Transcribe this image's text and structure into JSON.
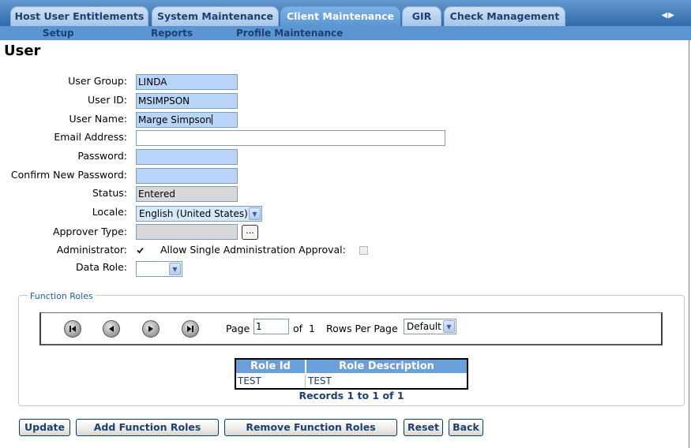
{
  "tabs": [
    {
      "label": "Host User Entitlements",
      "active": false
    },
    {
      "label": "System Maintenance",
      "active": false
    },
    {
      "label": "Client Maintenance",
      "active": true
    },
    {
      "label": "GIR",
      "active": false
    },
    {
      "label": "Check Management",
      "active": false
    }
  ],
  "tab_scroll_icon": "left-right-arrows",
  "subnav": [
    "Setup",
    "Reports",
    "Profile Maintenance"
  ],
  "page_title": "User",
  "form": {
    "user_group": {
      "label": "User Group:",
      "value": "LINDA"
    },
    "user_id": {
      "label": "User ID:",
      "value": "MSIMPSON"
    },
    "user_name": {
      "label": "User Name:",
      "value": "Marge Simpson"
    },
    "email": {
      "label": "Email Address:",
      "value": ""
    },
    "password": {
      "label": "Password:",
      "value": ""
    },
    "confirm_password": {
      "label": "Confirm New Password:",
      "value": ""
    },
    "status": {
      "label": "Status:",
      "value": "Entered"
    },
    "locale": {
      "label": "Locale:",
      "value": "English (United States)"
    },
    "approver_type": {
      "label": "Approver Type:",
      "value": "",
      "button": "..."
    },
    "administrator": {
      "label": "Administrator:",
      "checked": true
    },
    "allow_single_approval": {
      "label": "Allow Single Administration Approval:",
      "checked": false
    },
    "data_role": {
      "label": "Data Role:",
      "value": ""
    }
  },
  "function_roles": {
    "legend": "Function Roles",
    "pager": {
      "page_label": "Page",
      "page_value": "1",
      "of_label": "of",
      "total_pages": "1",
      "rows_per_page_label": "Rows Per Page",
      "rows_per_page_value": "Default"
    },
    "columns": [
      "Role Id",
      "Role Description"
    ],
    "rows": [
      [
        "TEST",
        "TEST"
      ]
    ],
    "records_text": "Records 1 to 1 of 1"
  },
  "buttons": {
    "update": "Update",
    "add_roles": "Add Function Roles",
    "remove_roles": "Remove Function Roles",
    "reset": "Reset",
    "back": "Back"
  },
  "colors": {
    "tab_bar": "#3c78b8",
    "active_tab": "#5b95d3",
    "input_highlight": "#b8d4f8",
    "table_header": "#6a9fd9"
  }
}
